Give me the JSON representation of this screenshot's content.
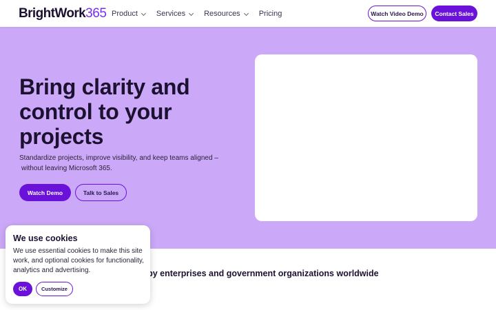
{
  "header": {
    "logo_word": "BrightWork",
    "logo_num": "365",
    "nav": [
      {
        "label": "Product",
        "has_dropdown": true
      },
      {
        "label": "Services",
        "has_dropdown": true
      },
      {
        "label": "Resources",
        "has_dropdown": true
      },
      {
        "label": "Pricing",
        "has_dropdown": false
      }
    ],
    "watch_video_label": "Watch Video Demo",
    "contact_label": "Contact Sales"
  },
  "hero": {
    "title": "Bring clarity and control to your projects",
    "subtitle_line1": "Standardize projects, improve visibility, and keep teams aligned –",
    "subtitle_line2": "without leaving Microsoft 365.",
    "primary_button": "Watch Demo",
    "secondary_button": "Talk to Sales"
  },
  "trusted": {
    "text": "d by enterprises and government organizations worldwide"
  },
  "cookie": {
    "title": "We use cookies",
    "text": "We use essential cookies to make this site work, and optional cookies for functionality, analytics and advertising.",
    "ok_label": "OK",
    "customize_label": "Customize"
  },
  "colors": {
    "accent": "#6a12d9",
    "hero_bg": "#cba9f8",
    "text_dark": "#1c1130"
  }
}
